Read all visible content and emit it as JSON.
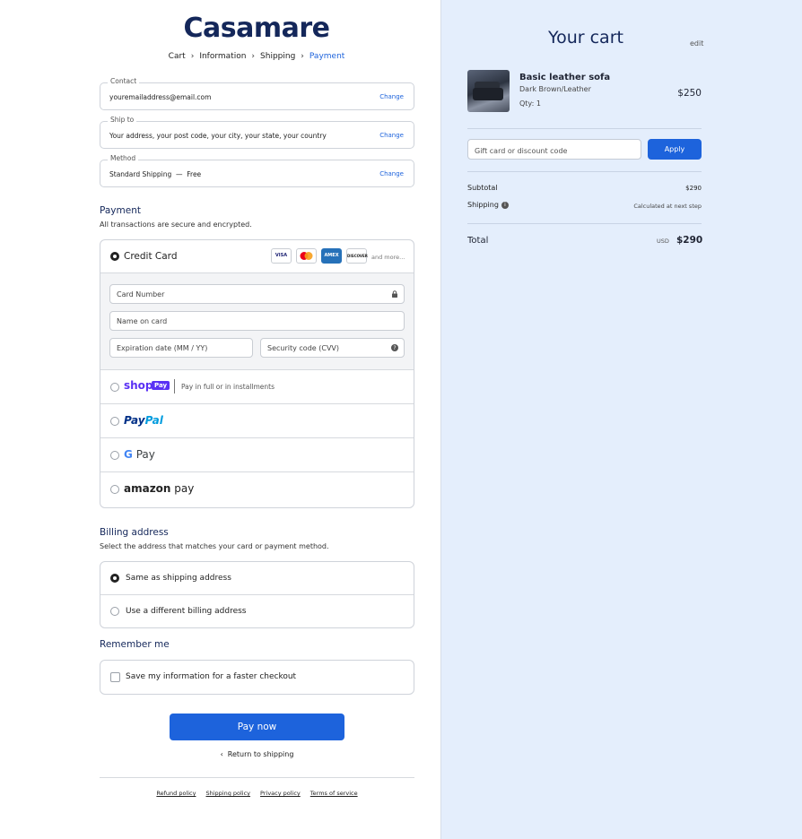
{
  "brand": {
    "logo": "Casamare"
  },
  "breadcrumb": {
    "items": [
      "Cart",
      "Information",
      "Shipping",
      "Payment"
    ],
    "separator": "›"
  },
  "summary_rows": {
    "contact": {
      "label": "Contact",
      "value": "youremailaddress@email.com",
      "action": "Change"
    },
    "ship_to": {
      "label": "Ship to",
      "value": "Your address, your post code, your city, your state, your country",
      "action": "Change"
    },
    "method": {
      "label": "Method",
      "value": "Standard Shipping  —  Free",
      "action": "Change"
    }
  },
  "payment": {
    "title": "Payment",
    "subtitle": "All transactions are secure and encrypted.",
    "credit_card_label": "Credit Card",
    "card_brands": [
      "VISA",
      "MC",
      "AMEX",
      "DISCOVER"
    ],
    "and_more": "and more...",
    "fields": {
      "card_number": "Card Number",
      "name_on_card": "Name on card",
      "expiration": "Expiration date (MM / YY)",
      "security": "Security code (CVV)"
    },
    "shop_pay": {
      "logo": "shop",
      "pill": "Pay",
      "note": "Pay in full or in installments"
    },
    "paypal": {
      "logo_a": "Pay",
      "logo_b": "Pal"
    },
    "gpay": {
      "logo": "Pay"
    },
    "amazon_pay": {
      "logo_a": "amazon",
      "logo_b": " pay"
    },
    "selected": "credit_card"
  },
  "billing": {
    "title": "Billing address",
    "subtitle": "Select the address that matches your card or payment method.",
    "options": [
      "Same as shipping address",
      "Use a different billing address"
    ],
    "selected_index": 0
  },
  "remember": {
    "title": "Remember me",
    "checkbox_label": "Save my information for a faster checkout",
    "checked": false
  },
  "actions": {
    "pay_now": "Pay now",
    "return": "Return to shipping"
  },
  "footer": {
    "links": [
      "Refund policy",
      "Shipping policy",
      "Privacy policy",
      "Terms of service"
    ]
  },
  "cart": {
    "title": "Your cart",
    "edit": "edit",
    "item": {
      "name": "Basic leather sofa",
      "variant": "Dark Brown/Leather",
      "qty": "Qty: 1",
      "price": "$250"
    },
    "discount_placeholder": "Gift card or discount code",
    "apply": "Apply",
    "subtotal_label": "Subtotal",
    "subtotal_value": "$290",
    "shipping_label": "Shipping",
    "shipping_value": "Calculated at next step",
    "total_label": "Total",
    "currency": "USD",
    "total_value": "$290"
  },
  "colors": {
    "accent": "#1d63dc",
    "brand_navy": "#14275a",
    "cart_bg": "#e4eefc",
    "shop_pay": "#5a31f4",
    "paypal_dark": "#003087",
    "paypal_light": "#009cde"
  }
}
